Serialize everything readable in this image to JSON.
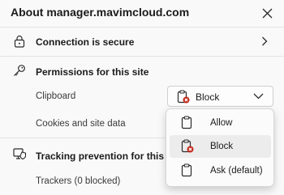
{
  "header": {
    "title": "About manager.mavimcloud.com",
    "close_icon": "close-icon"
  },
  "connection": {
    "label": "Connection is secure",
    "icon": "lock-icon",
    "chevron": "chevron-right-icon"
  },
  "permissions": {
    "heading": "Permissions for this site",
    "icon": "key-icon",
    "clipboard": {
      "label": "Clipboard",
      "selected_value": "Block",
      "icon": "clipboard-blocked-icon"
    },
    "cookies": {
      "label": "Cookies and site data"
    }
  },
  "dropdown_menu": {
    "options": [
      {
        "label": "Allow",
        "icon": "clipboard-icon",
        "selected": false
      },
      {
        "label": "Block",
        "icon": "clipboard-blocked-icon",
        "selected": true
      },
      {
        "label": "Ask (default)",
        "icon": "clipboard-icon",
        "selected": false
      }
    ]
  },
  "tracking": {
    "heading": "Tracking prevention for this site",
    "icon": "tracking-prevention-icon",
    "trackers": "Trackers (0 blocked)"
  },
  "colors": {
    "block_badge": "#c42b1c",
    "background": "#f9f9f9",
    "selected_item": "#ececec"
  }
}
